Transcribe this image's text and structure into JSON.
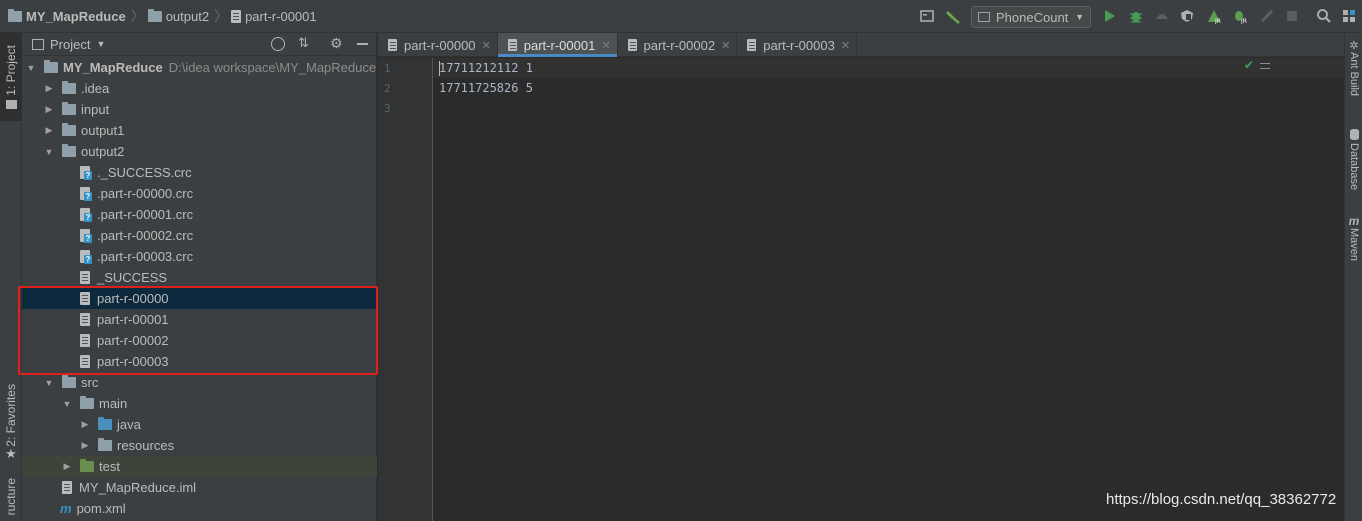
{
  "navbar": {
    "crumbs": [
      "MY_MapReduce",
      "output2",
      "part-r-00001"
    ],
    "run_config": "PhoneCount"
  },
  "left_stripe": {
    "project_tab": "1: Project",
    "favorites_tab": "2: Favorites",
    "structure_tab": "ructure"
  },
  "project_panel": {
    "title": "Project",
    "root_name": "MY_MapReduce",
    "root_path": "D:\\idea workspace\\MY_MapReduce",
    "items": [
      {
        "label": ".idea"
      },
      {
        "label": "input"
      },
      {
        "label": "output1"
      },
      {
        "label": "output2"
      },
      {
        "label": "._SUCCESS.crc"
      },
      {
        "label": ".part-r-00000.crc"
      },
      {
        "label": ".part-r-00001.crc"
      },
      {
        "label": ".part-r-00002.crc"
      },
      {
        "label": ".part-r-00003.crc"
      },
      {
        "label": "_SUCCESS"
      },
      {
        "label": "part-r-00000"
      },
      {
        "label": "part-r-00001"
      },
      {
        "label": "part-r-00002"
      },
      {
        "label": "part-r-00003"
      },
      {
        "label": "src"
      },
      {
        "label": "main"
      },
      {
        "label": "java"
      },
      {
        "label": "resources"
      },
      {
        "label": "test"
      },
      {
        "label": "MY_MapReduce.iml"
      },
      {
        "label": "pom.xml"
      }
    ]
  },
  "editor": {
    "tabs": [
      "part-r-00000",
      "part-r-00001",
      "part-r-00002",
      "part-r-00003"
    ],
    "active_tab": "part-r-00001",
    "line_numbers": [
      "1",
      "2",
      "3"
    ],
    "lines": [
      "17711212112 1",
      "17711725826 5",
      ""
    ]
  },
  "right_stripe": {
    "ant_build": "Ant Build",
    "database": "Database",
    "maven": "Maven"
  },
  "watermark": "https://blog.csdn.net/qq_38362772"
}
